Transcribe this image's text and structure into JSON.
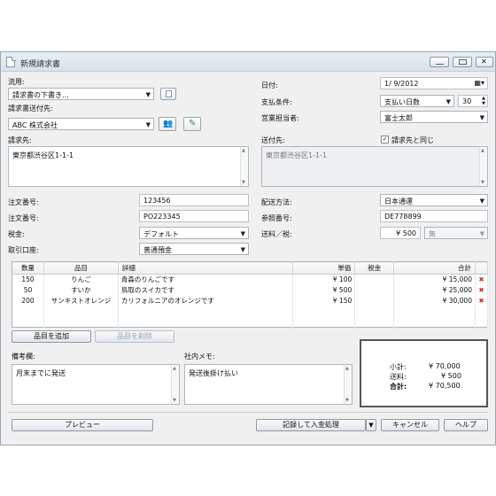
{
  "window": {
    "title": "新規請求書"
  },
  "form": {
    "type_label": "流用:",
    "type_value": "請求書の下書き...",
    "billto_label": "請求書送付先:",
    "billto_value": "ABC 株式会社",
    "billaddr_label": "請求先:",
    "billaddr_value": "東京都渋谷区1-1-1",
    "date_label": "日付:",
    "date_value": "1/ 9/2012",
    "terms_label": "支払条件:",
    "terms_value": "支払い日数",
    "terms_days": "30",
    "rep_label": "営業担当者:",
    "rep_value": "富士太郎",
    "ship_label": "送付先:",
    "same_as_bill": "請求先と同じ",
    "shipaddr_value": "東京都渋谷区1-1-1",
    "order_label": "注文番号:",
    "order_value": "123456",
    "order2_label": "注文番号:",
    "order2_value": "PO223345",
    "tax_label": "税金:",
    "tax_value": "デフォルト",
    "account_label": "取引口座:",
    "account_value": "普通預金",
    "ship_method_label": "配送方法:",
    "ship_method_value": "日本通運",
    "ref_label": "参照番号:",
    "ref_value": "DE778899",
    "shipping_label": "送料／税:",
    "shipping_value": "¥ 500",
    "shipping_tax": "無"
  },
  "table": {
    "headers": [
      "数量",
      "品目",
      "詳細",
      "単価",
      "税金",
      "合計"
    ],
    "rows": [
      {
        "qty": "150",
        "item": "りんご",
        "detail": "青森のりんごです",
        "price": "¥ 100",
        "tax": "",
        "total": "¥ 15,000"
      },
      {
        "qty": "50",
        "item": "すいか",
        "detail": "鳥取のスイカです",
        "price": "¥ 500",
        "tax": "",
        "total": "¥ 25,000"
      },
      {
        "qty": "200",
        "item": "サンキストオレンジ",
        "detail": "カリフォルニアのオレンジです",
        "price": "¥ 150",
        "tax": "",
        "total": "¥ 30,000"
      }
    ]
  },
  "buttons": {
    "add_item": "品目を追加",
    "remove_item": "品目を削除",
    "preview": "プレビュー",
    "record": "記録して入金処理",
    "cancel": "キャンセル",
    "help": "ヘルプ"
  },
  "notes": {
    "memo_label": "備考欄:",
    "memo_value": "月末までに発送",
    "internal_label": "社内メモ:",
    "internal_value": "発送後掛け払い"
  },
  "summary": {
    "subtotal_label": "小計:",
    "subtotal_value": "¥ 70,000",
    "shipping_label": "送料:",
    "shipping_value": "¥ 500",
    "total_label": "合計:",
    "total_value": "¥ 70,500"
  }
}
